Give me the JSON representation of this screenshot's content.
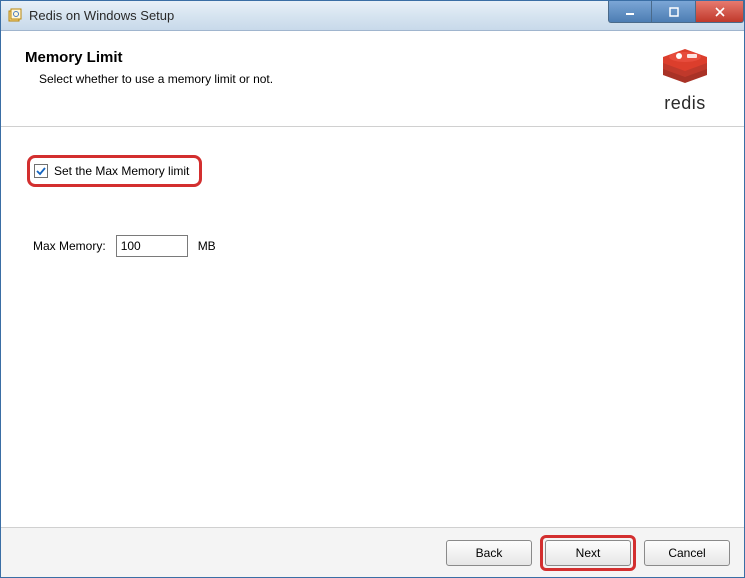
{
  "window": {
    "title": "Redis on Windows Setup"
  },
  "header": {
    "title": "Memory Limit",
    "subtitle": "Select whether to use a memory limit or not.",
    "logo_text": "redis"
  },
  "content": {
    "checkbox_label": "Set the Max Memory limit",
    "checkbox_checked": true,
    "memory_label": "Max Memory:",
    "memory_value": "100",
    "memory_unit": "MB"
  },
  "footer": {
    "back": "Back",
    "next": "Next",
    "cancel": "Cancel"
  }
}
